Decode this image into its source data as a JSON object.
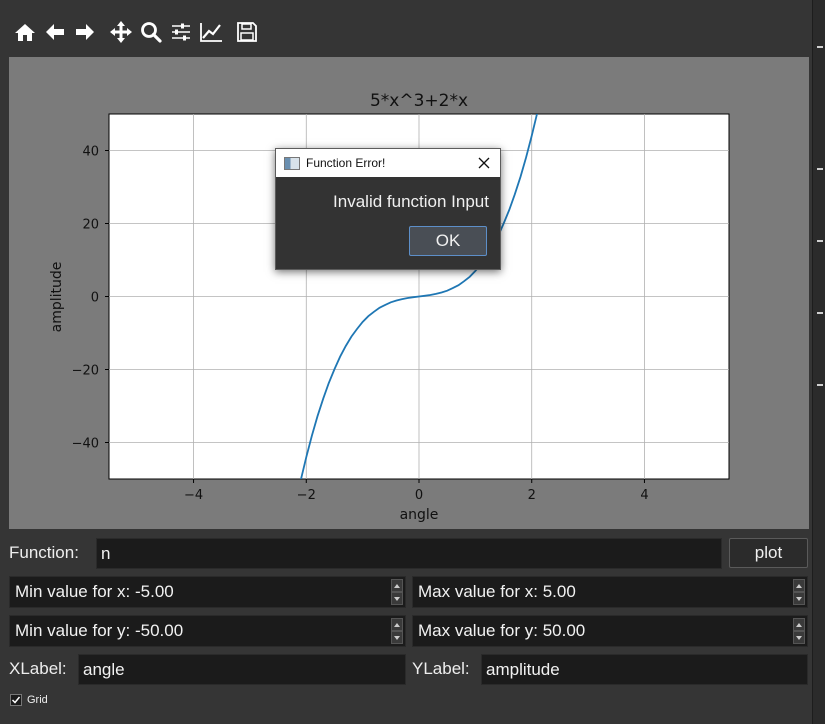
{
  "toolbar": {
    "icons": [
      "home-icon",
      "back-arrow-icon",
      "forward-arrow-icon",
      "pan-move-icon",
      "zoom-magnifier-icon",
      "configure-subplots-icon",
      "edit-axes-icon",
      "save-floppy-icon"
    ]
  },
  "chart_data": {
    "type": "line",
    "title": "5*x^3+2*x",
    "xlabel": "angle",
    "ylabel": "amplitude",
    "xlim": [
      -5.5,
      5.5
    ],
    "ylim": [
      -50,
      50
    ],
    "grid": true,
    "x_ticks": [
      -4,
      -2,
      0,
      2,
      4
    ],
    "x_tick_labels": [
      "−4",
      "−2",
      "0",
      "2",
      "4"
    ],
    "y_ticks": [
      -40,
      -20,
      0,
      20,
      40
    ],
    "y_tick_labels": [
      "−40",
      "−20",
      "0",
      "20",
      "40"
    ],
    "series": [
      {
        "color": "#1f77b4",
        "x": [
          -2.1,
          -2.0,
          -1.9,
          -1.8,
          -1.7,
          -1.6,
          -1.5,
          -1.4,
          -1.3,
          -1.2,
          -1.1,
          -1.0,
          -0.9,
          -0.8,
          -0.7,
          -0.6,
          -0.5,
          -0.4,
          -0.3,
          -0.2,
          -0.1,
          0.0,
          0.1,
          0.2,
          0.3,
          0.4,
          0.5,
          0.6,
          0.7,
          0.8,
          0.9,
          1.0,
          1.1,
          1.2,
          1.3,
          1.4,
          1.5,
          1.6,
          1.7,
          1.8,
          1.9,
          2.0,
          2.1
        ],
        "y": [
          -50.5,
          -44.0,
          -38.1,
          -32.8,
          -28.0,
          -23.7,
          -19.9,
          -16.5,
          -13.6,
          -11.0,
          -8.9,
          -7.0,
          -5.4,
          -4.2,
          -3.1,
          -2.3,
          -1.6,
          -1.1,
          -0.7,
          -0.4,
          -0.2,
          0.0,
          0.2,
          0.4,
          0.7,
          1.1,
          1.6,
          2.3,
          3.1,
          4.2,
          5.4,
          7.0,
          8.9,
          11.0,
          13.6,
          16.5,
          19.9,
          23.7,
          28.0,
          32.8,
          38.1,
          44.0,
          50.5
        ]
      }
    ]
  },
  "dialog": {
    "title": "Function Error!",
    "message": "Invalid function Input",
    "ok_label": "OK"
  },
  "form": {
    "function_label": "Function:",
    "function_value": "n",
    "plot_label": "plot",
    "min_x": "Min value for x: -5.00",
    "max_x": "Max value for x: 5.00",
    "min_y": "Min value for y: -50.00",
    "max_y": "Max value for y: 50.00",
    "xlabel_label": "XLabel:",
    "xlabel_value": "angle",
    "ylabel_label": "YLabel:",
    "ylabel_value": "amplitude",
    "grid_label": "Grid",
    "grid_checked": true
  }
}
